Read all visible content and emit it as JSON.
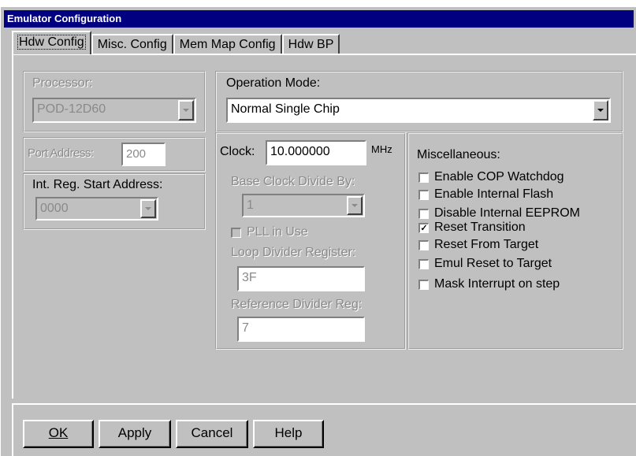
{
  "window": {
    "title": "Emulator Configuration"
  },
  "tabs": [
    {
      "label": "Hdw Config",
      "active": true
    },
    {
      "label": "Misc. Config",
      "active": false
    },
    {
      "label": "Mem Map Config",
      "active": false
    },
    {
      "label": "Hdw BP",
      "active": false
    }
  ],
  "processor": {
    "label": "Processor:",
    "value": "POD-12D60"
  },
  "operation_mode": {
    "label": "Operation Mode:",
    "value": "Normal Single Chip"
  },
  "port_address": {
    "label": "Port Address:",
    "value": "200"
  },
  "int_reg": {
    "label": "Int. Reg. Start Address:",
    "value": "0000"
  },
  "clock": {
    "label": "Clock:",
    "value": "10.000000",
    "unit": "MHz",
    "base_divide_label": "Base Clock Divide By:",
    "base_divide_value": "1",
    "pll_label": "PLL in Use",
    "loop_divider_label": "Loop Divider Register:",
    "loop_divider_value": "3F",
    "ref_divider_label": "Reference Divider Reg:",
    "ref_divider_value": "7"
  },
  "misc": {
    "label": "Miscellaneous:",
    "items": [
      {
        "label": "Enable COP Watchdog",
        "checked": false
      },
      {
        "label": "Enable Internal Flash",
        "checked": false
      },
      {
        "label": "Disable Internal EEPROM",
        "checked": false
      },
      {
        "label": "Reset Transition",
        "checked": true
      },
      {
        "label": "Reset From Target",
        "checked": false
      },
      {
        "label": "Emul Reset to Target",
        "checked": false
      },
      {
        "label": "Mask Interrupt on step",
        "checked": false
      }
    ]
  },
  "buttons": {
    "ok": "OK",
    "apply": "Apply",
    "cancel": "Cancel",
    "help": "Help"
  }
}
